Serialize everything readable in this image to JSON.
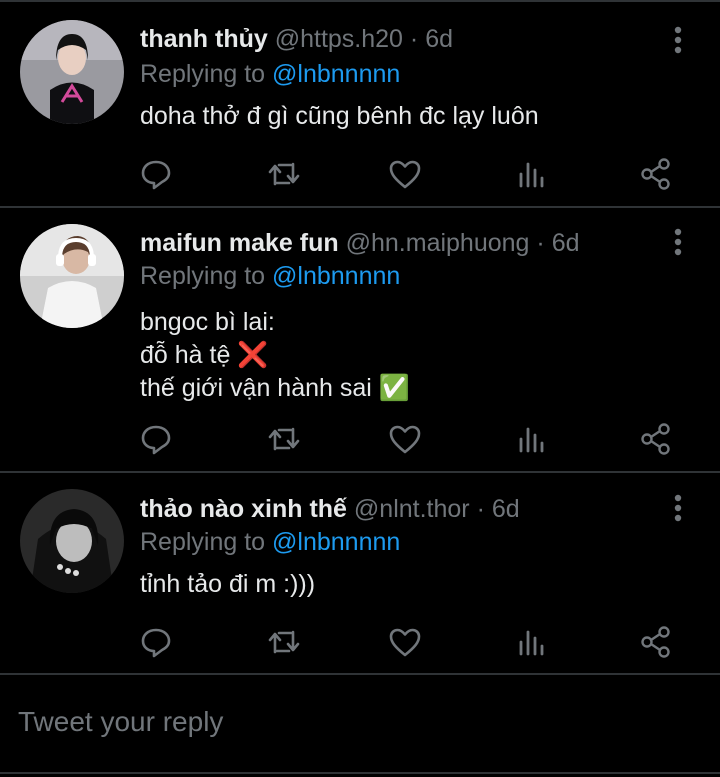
{
  "tweets": [
    {
      "name": "thanh thủy",
      "handle": "@https.h20",
      "dot": "·",
      "time": "6d",
      "replying_prefix": "Replying to ",
      "replying_to": "@lnbnnnnn",
      "lines": [
        "doha thở đ gì cũng bênh đc lạy luôn"
      ],
      "avatar": "avatar-girl-black-shirt"
    },
    {
      "name": "maifun make fun",
      "handle": "@hn.maiphuong",
      "dot": "·",
      "time": "6d",
      "replying_prefix": "Replying to ",
      "replying_to": "@lnbnnnnn",
      "lines": [
        "bngoc bì lai:",
        "đỗ hà tệ",
        "thế giới vận hành sai"
      ],
      "avatar": "avatar-headphones"
    },
    {
      "name": "thảo nào xinh thế",
      "handle": "@nlnt.thor",
      "dot": "·",
      "time": "6d",
      "replying_prefix": "Replying to ",
      "replying_to": "@lnbnnnnn",
      "lines": [
        "tỉnh tảo đi m :)))"
      ],
      "avatar": "avatar-monochrome-girl"
    }
  ],
  "emoji": {
    "cross": "❌",
    "check": "✅"
  },
  "icons": [
    "reply-icon",
    "retweet-icon",
    "like-icon",
    "views-icon",
    "share-icon",
    "more-icon"
  ],
  "reply_box": {
    "placeholder": "Tweet your reply"
  },
  "colors": {
    "background": "#000000",
    "text": "#e7e9ea",
    "muted": "#71767b",
    "link": "#1d9bf0",
    "divider": "#2f3336"
  }
}
